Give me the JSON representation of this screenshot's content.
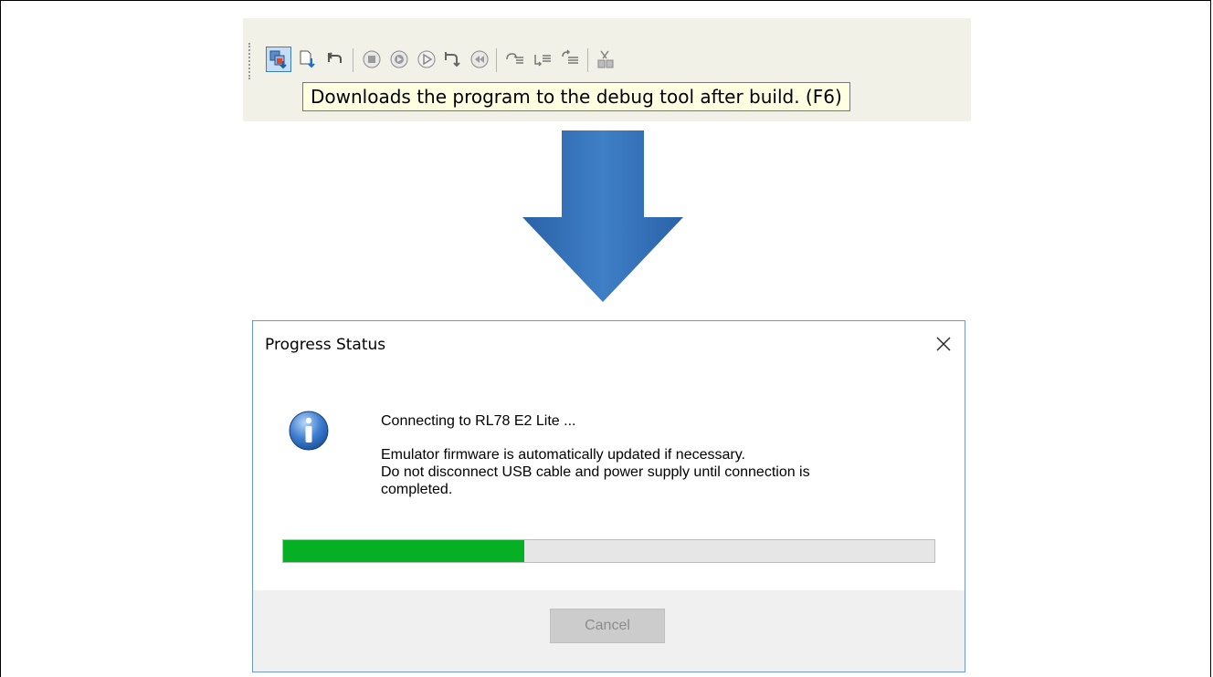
{
  "toolbar": {
    "tooltip": "Downloads the program to the debug tool after build. (F6)",
    "buttons": [
      {
        "name": "build-download-button",
        "icon": "build-download-icon",
        "active": true
      },
      {
        "name": "download-button",
        "icon": "download-icon"
      },
      {
        "name": "disconnect-button",
        "icon": "disconnect-icon"
      },
      {
        "name": "stop-button",
        "icon": "stop-icon"
      },
      {
        "name": "go-button",
        "icon": "go-icon"
      },
      {
        "name": "run-button",
        "icon": "run-icon"
      },
      {
        "name": "cpu-reset-button",
        "icon": "cpu-reset-icon"
      },
      {
        "name": "restart-button",
        "icon": "restart-icon"
      },
      {
        "name": "step-in-button",
        "icon": "step-in-icon"
      },
      {
        "name": "step-over-button",
        "icon": "step-over-icon"
      },
      {
        "name": "return-out-button",
        "icon": "return-out-icon"
      },
      {
        "name": "trace-button",
        "icon": "trace-icon"
      }
    ]
  },
  "arrow": {
    "color": "#3a74b8",
    "icon": "down-arrow-icon"
  },
  "dialog": {
    "title": "Progress Status",
    "close_icon": "close-icon",
    "info_icon": "info-icon",
    "message_line1": "Connecting to RL78 E2 Lite ...",
    "message_line2": "Emulator firmware is automatically updated if necessary.",
    "message_line3": "Do not disconnect USB cable and power supply until connection is",
    "message_line4": "completed.",
    "progress_percent": 37,
    "progress_color": "#06b025",
    "cancel_label": "Cancel"
  }
}
